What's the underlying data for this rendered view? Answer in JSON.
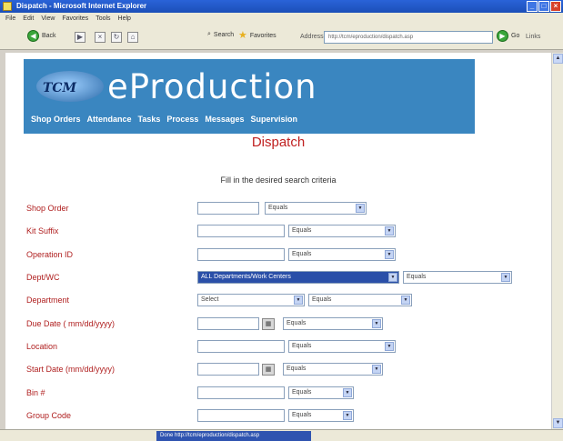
{
  "window": {
    "title": "Dispatch - Microsoft Internet Explorer",
    "min": "_",
    "max": "□",
    "close": "×"
  },
  "menu": [
    "File",
    "Edit",
    "View",
    "Favorites",
    "Tools",
    "Help"
  ],
  "toolbar": {
    "back": "Back",
    "search": "Search",
    "favorites": "Favorites",
    "address_label": "Address",
    "address": "http://tcm/eproduction/dispatch.asp",
    "go": "Go",
    "links": "Links"
  },
  "banner": {
    "logo": "TCM",
    "brand": "eProduction",
    "nav": [
      "Shop Orders",
      "Attendance",
      "Tasks",
      "Process",
      "Messages",
      "Supervision"
    ]
  },
  "page": {
    "title": "Dispatch",
    "instructions": "Fill in the desired search criteria"
  },
  "form": {
    "rows": [
      {
        "label": "Shop Order",
        "value": "",
        "op": "Equals"
      },
      {
        "label": "Kit Suffix",
        "value": "",
        "op": "Equals"
      },
      {
        "label": "Operation ID",
        "value": "",
        "op": "Equals"
      },
      {
        "label": "Dept/WC",
        "value": "ALL Departments/Work Centers",
        "op": "Equals"
      },
      {
        "label": "Department",
        "value": "Select",
        "op": "Equals"
      },
      {
        "label": "Due Date ( mm/dd/yyyy)",
        "value": "",
        "op": "Equals"
      },
      {
        "label": "Location",
        "value": "",
        "op": "Equals"
      },
      {
        "label": "Start Date (mm/dd/yyyy)",
        "value": "",
        "op": "Equals"
      },
      {
        "label": "Bin #",
        "value": "",
        "op": "Equals"
      },
      {
        "label": "Group Code",
        "value": "",
        "op": "Equals"
      }
    ]
  },
  "status": "Done  http://tcm/eproduction/dispatch.asp",
  "colors": {
    "banner": "#3a86c0",
    "label": "#b02020",
    "title_bar": "#2a63d8"
  }
}
